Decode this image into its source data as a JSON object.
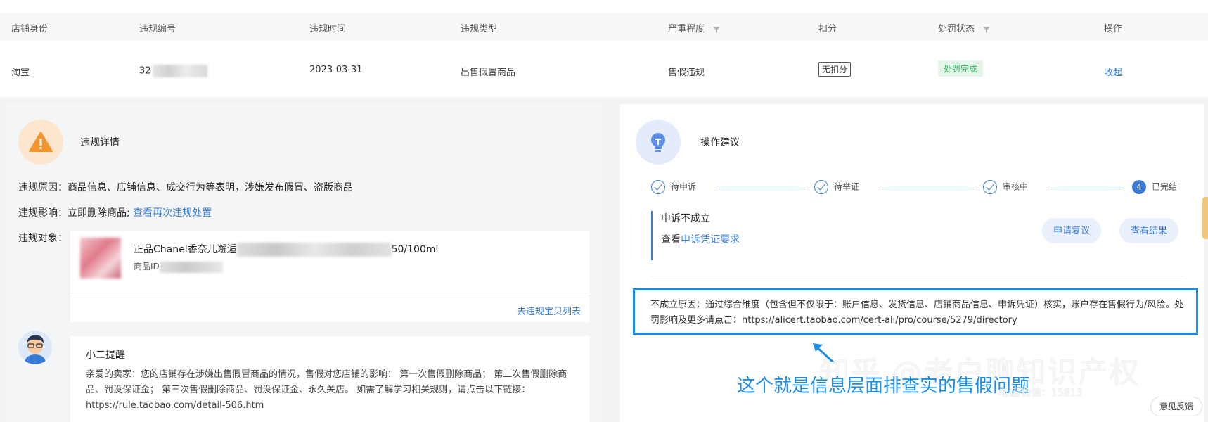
{
  "table": {
    "headers": {
      "shop_identity": "店铺身份",
      "violation_id": "违规编号",
      "violation_time": "违规时间",
      "violation_type": "违规类型",
      "severity": "严重程度",
      "deduction": "扣分",
      "penalty_status": "处罚状态",
      "action": "操作"
    },
    "row": {
      "shop_identity": "淘宝",
      "violation_id_prefix": "32",
      "violation_time": "2023-03-31",
      "violation_type": "出售假冒商品",
      "severity": "售假违规",
      "deduction": "无扣分",
      "penalty_status": "处罚完成",
      "action": "收起"
    }
  },
  "details": {
    "title": "违规详情",
    "reason_label": "违规原因：",
    "reason_value": "商品信息、店铺信息、成交行为等表明，涉嫌发布假冒、盗版商品",
    "impact_label": "违规影响：",
    "impact_value": "立即删除商品;",
    "impact_link": "查看再次违规处置",
    "object_label": "违规对象：",
    "product_name_start": "正品Chanel香奈儿邂逅",
    "product_name_end": "50/100ml",
    "product_id_label": "商品ID",
    "product_list_link": "去违规宝贝列表"
  },
  "reminder": {
    "title": "小二提醒",
    "body": "亲爱的卖家：您的店铺存在涉嫌出售假冒商品的情况，售假对您店铺的影响： 第一次售假删除商品； 第二次售假删除商品、罚没保证金； 第三次售假删除商品、罚没保证金、永久关店。 如需了解学习相关规则，请点击以下链接：https://rule.taobao.com/detail-506.htm"
  },
  "advice": {
    "title": "操作建议",
    "steps": [
      {
        "label": "待申诉",
        "state": "done"
      },
      {
        "label": "待举证",
        "state": "done"
      },
      {
        "label": "审核中",
        "state": "done"
      },
      {
        "label": "已完结",
        "state": "current",
        "number": "4"
      }
    ],
    "result_title": "申诉不成立",
    "result_prefix": "查看",
    "result_link": "申诉凭证要求",
    "btn_review": "申请复议",
    "btn_result": "查看结果",
    "reason_text": "不成立原因：通过综合维度（包含但不仅限于：账户信息、发货信息、店铺商品信息、申诉凭证）核实，账户存在售假行为/风险。处罚影响及更多请点击：https://alicert.taobao.com/cert-ali/pro/course/5279/directory"
  },
  "annotation": {
    "text": "这个就是信息层面排查实的售假问题",
    "watermark": "知乎 @老白聊知识产权",
    "watermark_small": "电话/微信：15813"
  },
  "feedback_label": "意见反馈",
  "colors": {
    "accent": "#3a7bd5",
    "highlight": "#1a8ee6",
    "success": "#2bb45a",
    "warning_bg": "#fde6cf"
  }
}
